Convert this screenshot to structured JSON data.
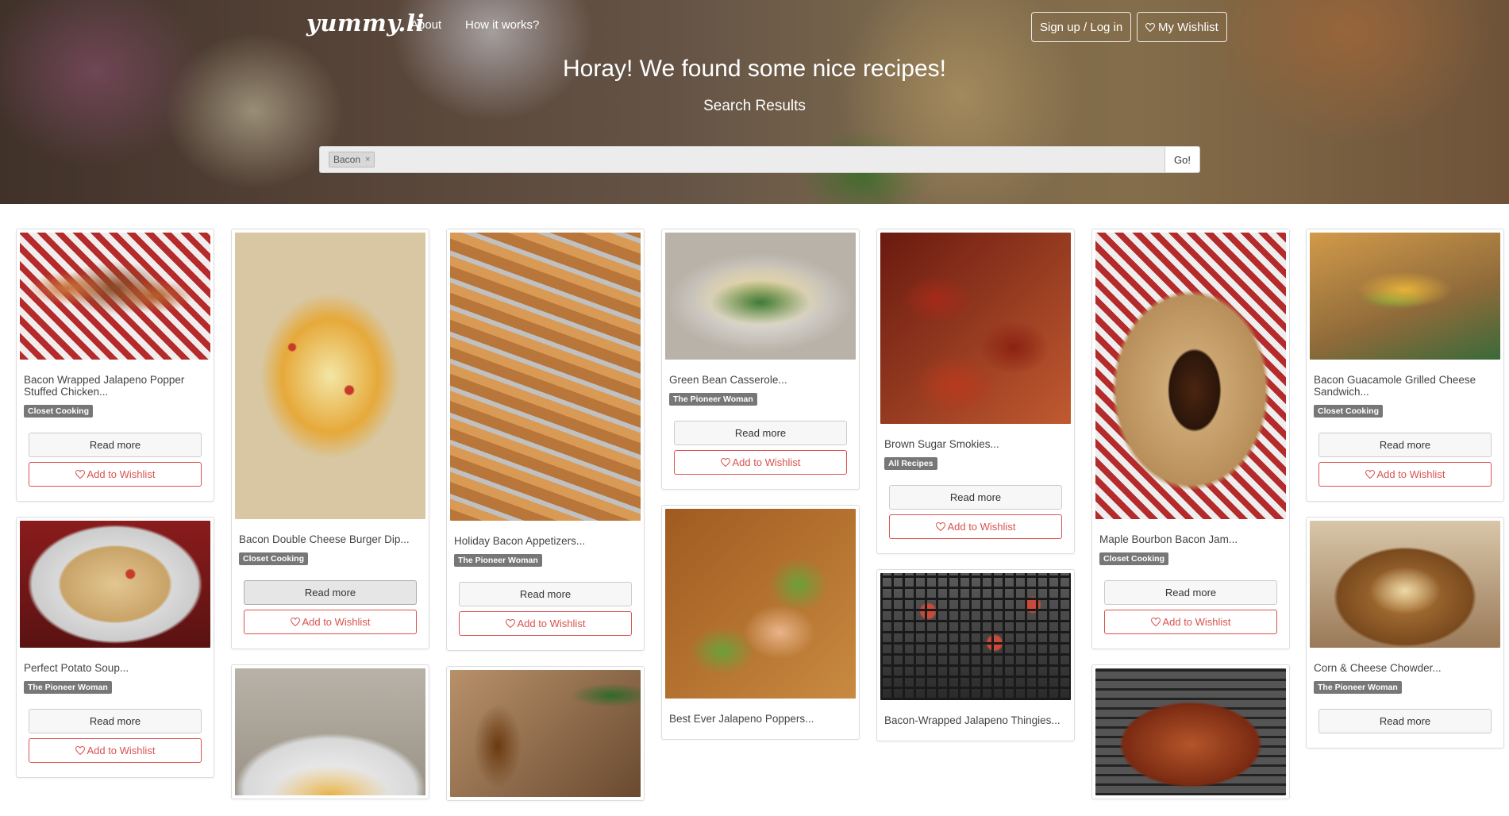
{
  "header": {
    "brand": "yummy.li",
    "nav": {
      "about": "About",
      "how": "How it works?"
    },
    "signup_label": "Sign up / Log in",
    "wishlist_label": "My Wishlist",
    "title": "Horay! We found some nice recipes!",
    "subtitle": "Search Results"
  },
  "search": {
    "tag": "Bacon",
    "tag_remove": "×",
    "placeholder": "",
    "go_label": "Go!"
  },
  "card_actions": {
    "read_more": "Read more",
    "add_wishlist": "Add to Wishlist"
  },
  "recipes": [
    {
      "title": "Bacon Wrapped Jalapeno Popper Stuffed Chicken...",
      "source": "Closet Cooking"
    },
    {
      "title": "Perfect Potato Soup...",
      "source": "The Pioneer Woman"
    },
    {
      "title": "Bacon Double Cheese Burger Dip...",
      "source": "Closet Cooking"
    },
    {
      "title": "Holiday Bacon Appetizers...",
      "source": "The Pioneer Woman"
    },
    {
      "title": "Green Bean Casserole...",
      "source": "The Pioneer Woman"
    },
    {
      "title": "Best Ever Jalapeno Poppers...",
      "source": ""
    },
    {
      "title": "Brown Sugar Smokies...",
      "source": "All Recipes"
    },
    {
      "title": "Bacon-Wrapped Jalapeno Thingies...",
      "source": ""
    },
    {
      "title": "Maple Bourbon Bacon Jam...",
      "source": "Closet Cooking"
    },
    {
      "title": "Bacon Guacamole Grilled Cheese Sandwich...",
      "source": "Closet Cooking"
    },
    {
      "title": "Corn & Cheese Chowder...",
      "source": "The Pioneer Woman"
    }
  ],
  "colors": {
    "accent": "#d9534f",
    "badge": "#777777"
  },
  "icons": {
    "heart": "heart-icon"
  }
}
